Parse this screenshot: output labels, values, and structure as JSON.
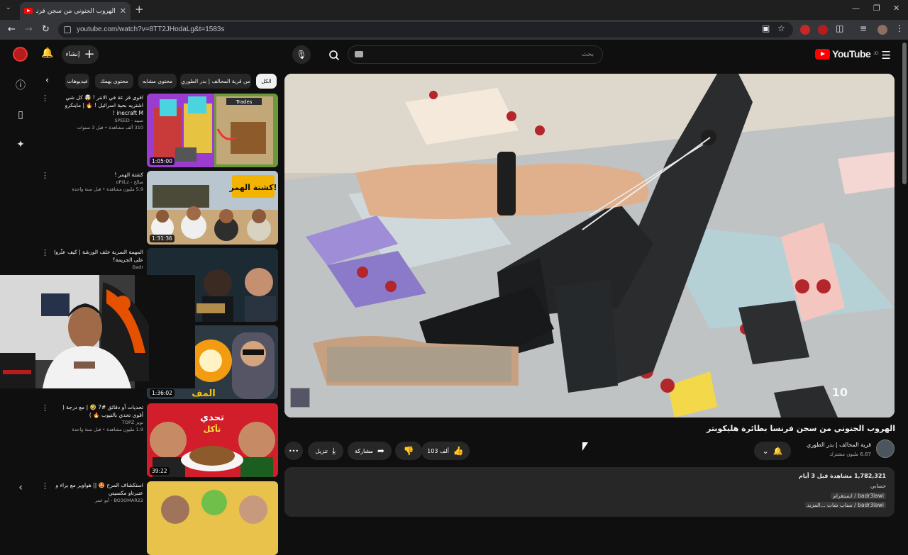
{
  "browser": {
    "tab_title": "الهروب الجنوني من سجن فرنسا",
    "url": "youtube.com/watch?v=8TT2JHodaLg&t=1583s",
    "new_tab_label": "+",
    "tab_close": "✕",
    "tab_menu": "⌄",
    "win_minimize": "—",
    "win_maximize": "❐",
    "win_close": "✕"
  },
  "masthead": {
    "logo_text": "YouTube",
    "logo_region": "JO",
    "search_placeholder": "بحث",
    "create_label": "إنشاء"
  },
  "chips": [
    {
      "label": "الكل",
      "active": true
    },
    {
      "label": "من قرية المحالف | بدر الطوري",
      "active": false
    },
    {
      "label": "محتوى مشابه",
      "active": false
    },
    {
      "label": "محتوى يهمك",
      "active": false
    },
    {
      "label": "فيديوهات",
      "active": false
    }
  ],
  "related": [
    {
      "title": "اقوى فز عة في الانتر ! 🤯 كل شي اشتريه بحية اسرائيل ! 🔥 | ماينكرو inecraft M !",
      "channel": "سبيد - SPEED",
      "stats": "310 ألف مشاهدة • قبل 3 سنوات",
      "duration": "1:05:00"
    },
    {
      "title": "كشتة الهمر !",
      "channel": "صالح - oPiiLz",
      "stats": "5.9 مليون مشاهدة • قبل سنة واحدة",
      "duration": "1:31:36"
    },
    {
      "title": "المهمة السرية خلف الورشة | كيف عثّروا على الجريمة؟",
      "channel": "Badr",
      "stats": "",
      "duration": ""
    },
    {
      "title": "",
      "channel": "",
      "stats": "",
      "duration": "1:36:02"
    },
    {
      "title": "تحديات أو دقائق #7 🤣 | مع درجة ( أقوى تحدي بالتيوب 🔥 )",
      "channel": "تويز TOPZ",
      "stats": "1.9 مليون مشاهدة • قبل سنة واحدة",
      "duration": "39:22"
    },
    {
      "title": "استكشاف المرح 🤩 || هواوير مع براء و عنبرتاو مكسيتي",
      "channel": "BO3OMAR22 - أبو عمر",
      "stats": "",
      "duration": ""
    }
  ],
  "thumb_text": {
    "trades": "Trades",
    "kashta": "كشتة الهمر!",
    "taheed": "تحدي",
    "taheed2": "تأكل",
    "almaf": "المف"
  },
  "video": {
    "title": "الهروب الجنوني من سجن فرنسا بطائرة هليكوبتر",
    "channel": "قرية المحالف | بدر الطوري",
    "subscribers": "6.87 مليون مشترك",
    "likes": "103 ألف",
    "share_label": "مشاركة",
    "download_label": "تنزيل",
    "more_label": "•••",
    "watermark": "10",
    "views_date": "1,782,321 مشاهدة قبل 3 أيام",
    "desc_line1": "حسابي",
    "desc_line2": "badr3lawi / انستغرام",
    "desc_line3": "badr3lawi / سناب شات ...المزيد"
  }
}
